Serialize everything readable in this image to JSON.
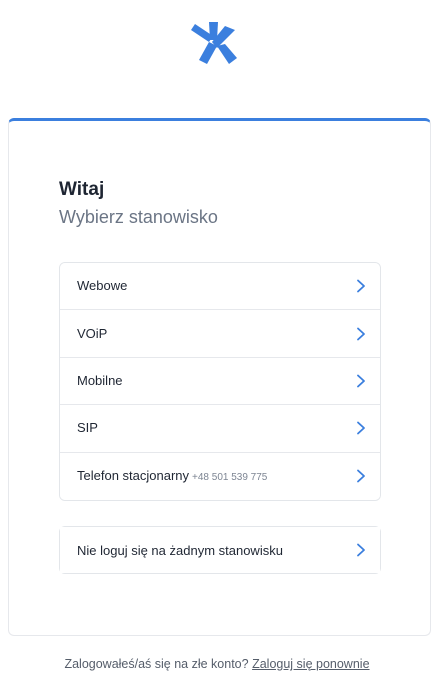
{
  "logo": {
    "icon": "brand-star-icon",
    "color": "#3b7fde"
  },
  "card": {
    "title": "Witaj",
    "subtitle": "Wybierz stanowisko",
    "items": [
      {
        "label": "Webowe",
        "sub": ""
      },
      {
        "label": "VOiP",
        "sub": ""
      },
      {
        "label": "Mobilne",
        "sub": ""
      },
      {
        "label": "SIP",
        "sub": ""
      },
      {
        "label": "Telefon stacjonarny",
        "sub": "+48 501 539 775"
      }
    ],
    "no_station": "Nie loguj się na żadnym stanowisku"
  },
  "footer": {
    "text": "Zalogowałeś/aś się na złe konto?",
    "link": "Zaloguj się ponownie"
  },
  "colors": {
    "accent": "#3b7fde",
    "border": "#e3e6ea"
  }
}
